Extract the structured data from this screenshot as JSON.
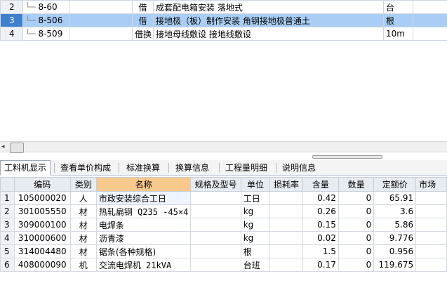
{
  "top_rows": [
    {
      "row": "2",
      "code": "8-60",
      "type": "借",
      "name": "成套配电箱安装 落地式",
      "unit": "台",
      "selected": false
    },
    {
      "row": "3",
      "code": "8-506",
      "type": "借",
      "name": "接地极（板）制作安装 角钢接地极普通土",
      "unit": "根",
      "selected": true
    },
    {
      "row": "4",
      "code": "8-509",
      "type": "借换",
      "name": "接地母线敷设 接地线敷设",
      "unit": "10m",
      "selected": false
    }
  ],
  "tabs": [
    "工料机显示",
    "查看单价构成",
    "标准换算",
    "换算信息",
    "工程量明细",
    "说明信息"
  ],
  "active_tab": 0,
  "columns": [
    "编码",
    "类别",
    "名称",
    "规格及型号",
    "单位",
    "损耗率",
    "含量",
    "数量",
    "定额价",
    "市场"
  ],
  "rows": [
    {
      "n": "1",
      "code": "105000020",
      "cat": "人",
      "name": "市政安装综合工日",
      "unit": "工日",
      "loss": "",
      "content": "0.42",
      "qty": "0",
      "price": "65.91"
    },
    {
      "n": "2",
      "code": "301005550",
      "cat": "材",
      "name": "热轧扁钢 Q235 -45×4",
      "unit": "kg",
      "loss": "",
      "content": "0.26",
      "qty": "0",
      "price": "3.6"
    },
    {
      "n": "3",
      "code": "309000100",
      "cat": "材",
      "name": "电焊条",
      "unit": "kg",
      "loss": "",
      "content": "0.15",
      "qty": "0",
      "price": "5.86"
    },
    {
      "n": "4",
      "code": "310000600",
      "cat": "材",
      "name": "沥青漆",
      "unit": "kg",
      "loss": "",
      "content": "0.02",
      "qty": "0",
      "price": "9.776"
    },
    {
      "n": "5",
      "code": "314004480",
      "cat": "材",
      "name": "锯条(各种规格)",
      "unit": "根",
      "loss": "",
      "content": "1.5",
      "qty": "0",
      "price": "0.956"
    },
    {
      "n": "6",
      "code": "408000090",
      "cat": "机",
      "name": "交流电焊机 21kVA",
      "unit": "台班",
      "loss": "",
      "content": "0.17",
      "qty": "0",
      "price": "119.675"
    }
  ],
  "scroll_arrow": "◂",
  "colors": {
    "selected_row": "#a9cdf4",
    "highlight_header": "#f7c98d"
  }
}
